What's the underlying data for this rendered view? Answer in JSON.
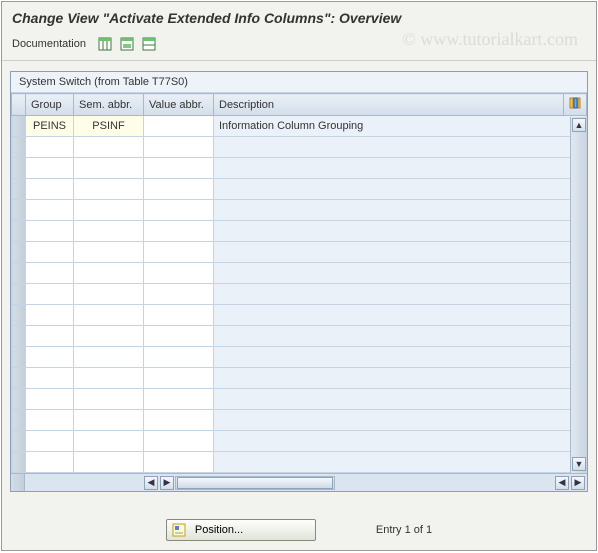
{
  "title": "Change View \"Activate Extended Info Columns\": Overview",
  "toolbar": {
    "doc_label": "Documentation"
  },
  "table": {
    "caption": "System Switch (from Table T77S0)",
    "headers": {
      "group": "Group",
      "sem": "Sem. abbr.",
      "val": "Value abbr.",
      "desc": "Description"
    },
    "rows": [
      {
        "group": "PEINS",
        "sem": "PSINF",
        "val": "",
        "desc": "Information Column Grouping"
      }
    ],
    "empty_row_count": 16
  },
  "footer": {
    "position_label": "Position...",
    "entry_text": "Entry 1 of 1"
  },
  "watermark": "© www.tutorialkart.com",
  "chart_data": {
    "type": "table",
    "title": "System Switch (from Table T77S0)",
    "columns": [
      "Group",
      "Sem. abbr.",
      "Value abbr.",
      "Description"
    ],
    "rows": [
      [
        "PEINS",
        "PSINF",
        "",
        "Information Column Grouping"
      ]
    ]
  }
}
